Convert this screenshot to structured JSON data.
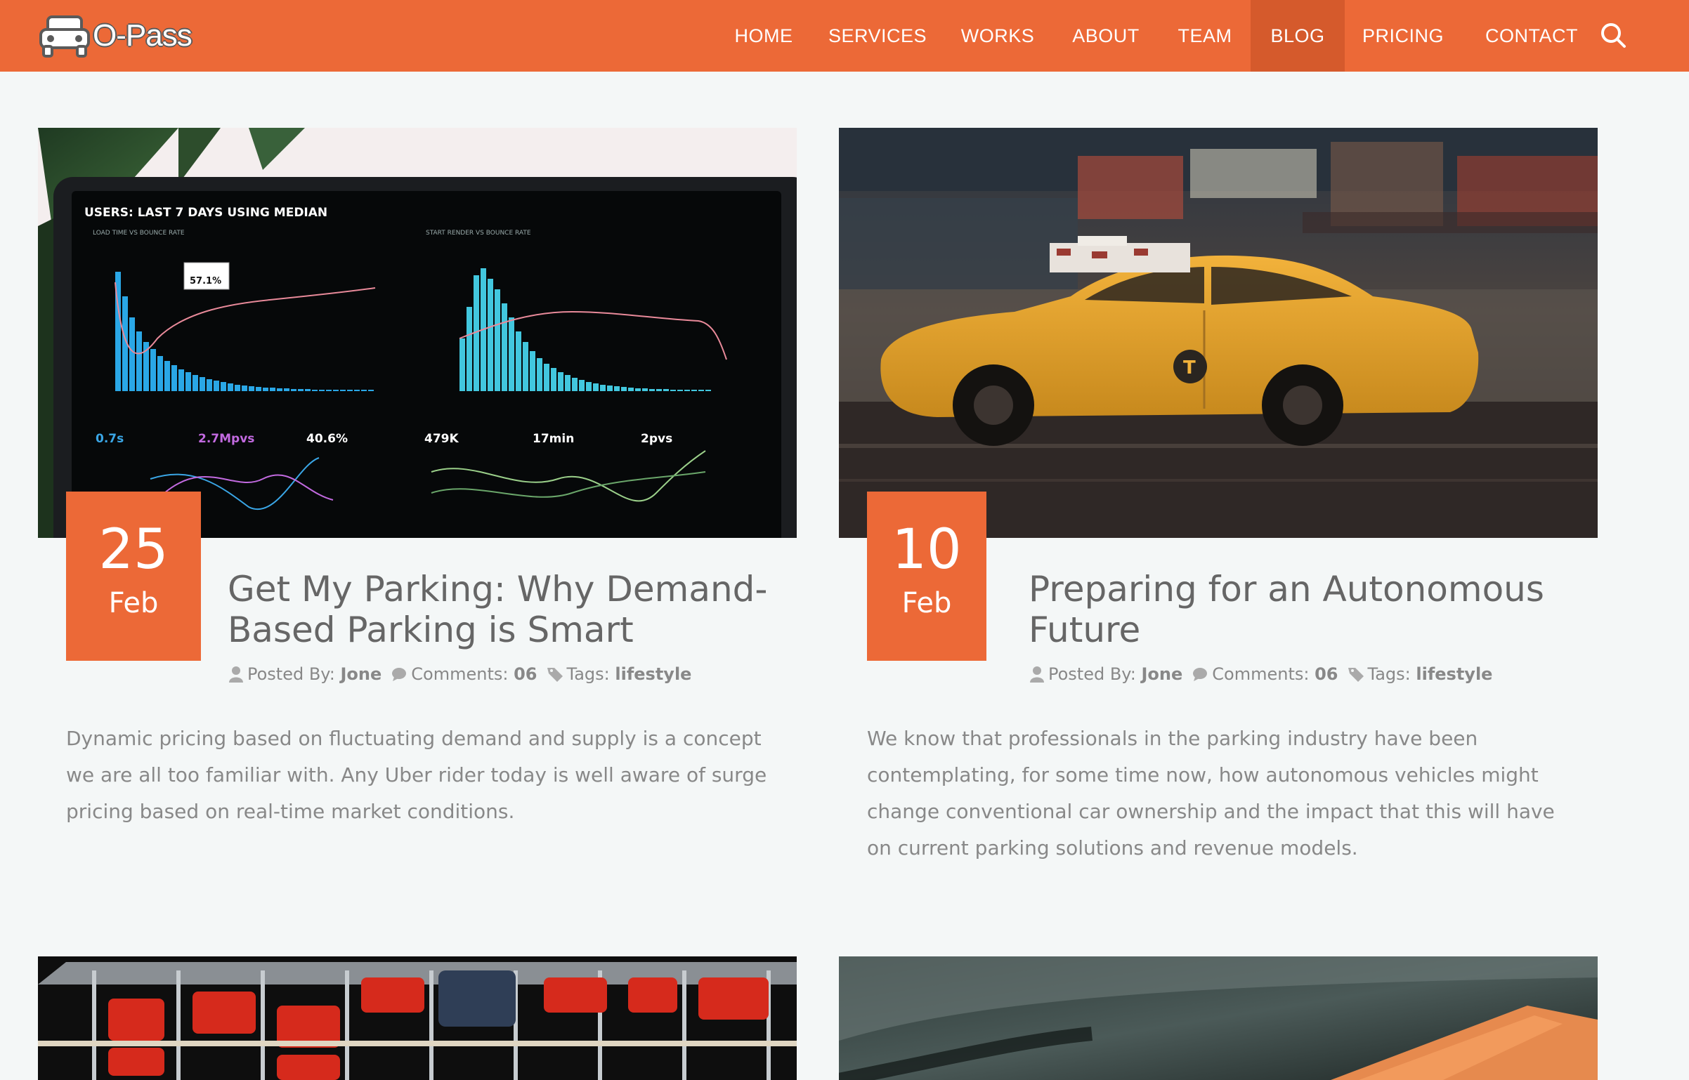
{
  "brand": {
    "name": "O-Pass",
    "accent": "#ec6937",
    "active_bg": "#d55a2c"
  },
  "nav": {
    "items": [
      {
        "label": "HOME"
      },
      {
        "label": "SERVICES"
      },
      {
        "label": "WORKS"
      },
      {
        "label": "ABOUT"
      },
      {
        "label": "TEAM"
      },
      {
        "label": "BLOG",
        "active": true
      },
      {
        "label": "PRICING"
      },
      {
        "label": "CONTACT"
      }
    ],
    "search_icon": "search-icon"
  },
  "posts": [
    {
      "day": "25",
      "month": "Feb",
      "title": "Get My Parking: Why Demand-Based Parking is Smart",
      "meta": {
        "posted_by_label": "Posted By:",
        "author": "Jone",
        "comments_label": "Comments:",
        "comments": "06",
        "tags_label": "Tags:",
        "tags": "lifestyle"
      },
      "excerpt": "Dynamic pricing based on fluctuating demand and supply is a concept we are all too familiar with. Any Uber rider today is well aware of surge pricing based on real-time market conditions.",
      "image": {
        "dashboard_heading": "USERS: LAST 7 DAYS USING MEDIAN",
        "panel1_title": "LOAD TIME VS BOUNCE RATE",
        "panel2_title": "START RENDER VS BOUNCE RATE",
        "tooltip": "57.1%",
        "stats": [
          "0.7s",
          "2.7Mpvs",
          "40.6%",
          "479K",
          "17min",
          "2pvs"
        ]
      }
    },
    {
      "day": "10",
      "month": "Feb",
      "title": "Preparing for an Autonomous Future",
      "meta": {
        "posted_by_label": "Posted By:",
        "author": "Jone",
        "comments_label": "Comments:",
        "comments": "06",
        "tags_label": "Tags:",
        "tags": "lifestyle"
      },
      "excerpt": "We know that professionals in the parking industry have been contemplating, for some time now, how autonomous vehicles might change conventional car ownership and the impact that this will have on current parking solutions and revenue models."
    }
  ]
}
